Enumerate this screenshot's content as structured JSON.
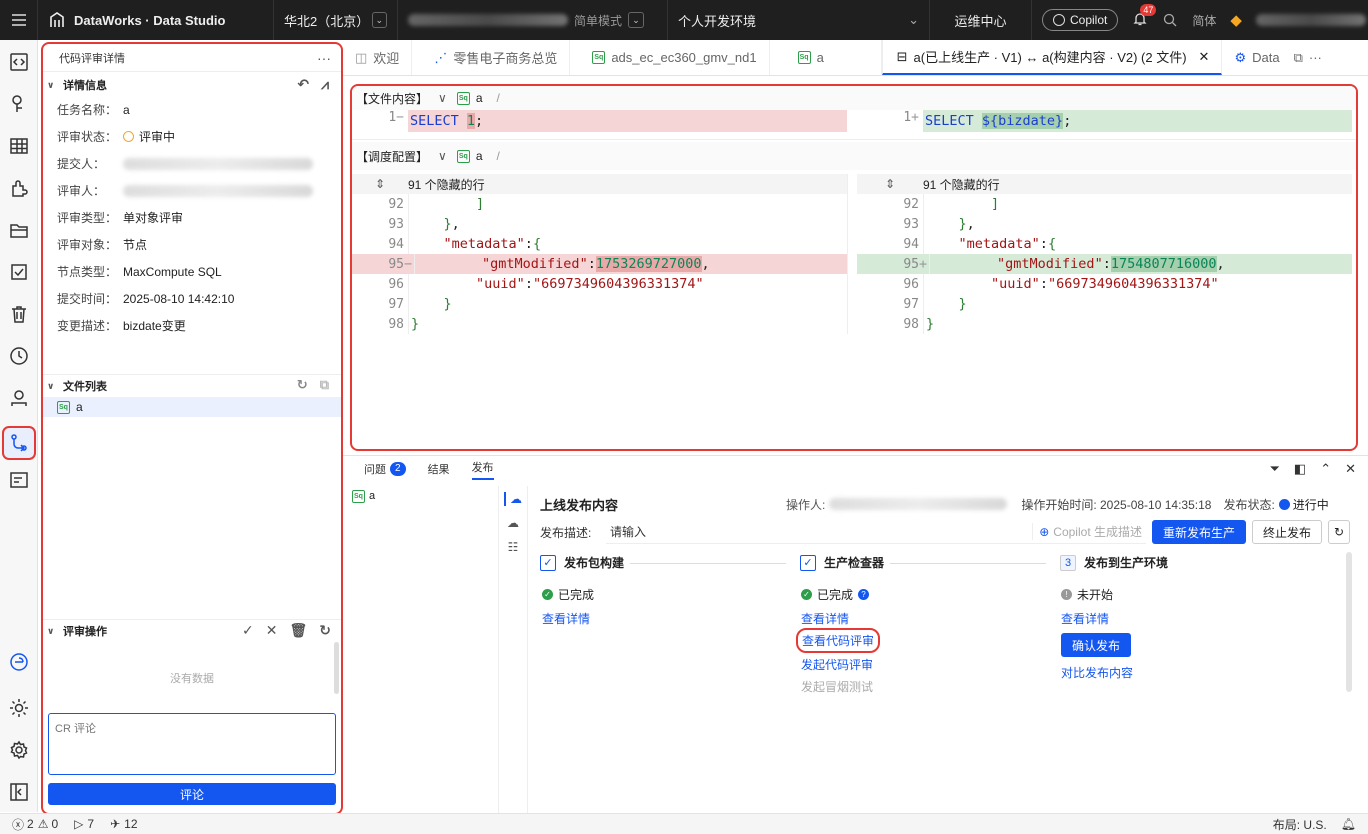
{
  "topbar": {
    "menu_icon": "menu-icon",
    "logo_text": "DataWorks · Data Studio",
    "region": "华北2（北京）",
    "mode": "简单模式",
    "environment": "个人开发环境",
    "ops_center": "运维中心",
    "copilot": "Copilot",
    "notifications": "47",
    "language": "简体"
  },
  "left_panel": {
    "title": "代码评审详情",
    "details_section": "详情信息",
    "fields": [
      {
        "key": "任务名称：",
        "value": "a"
      },
      {
        "key": "评审状态：",
        "value": "评审中"
      },
      {
        "key": "提交人：",
        "value": ""
      },
      {
        "key": "评审人：",
        "value": ""
      },
      {
        "key": "评审类型：",
        "value": "单对象评审"
      },
      {
        "key": "评审对象：",
        "value": "节点"
      },
      {
        "key": "节点类型：",
        "value": "MaxCompute SQL"
      },
      {
        "key": "提交时间：",
        "value": "2025-08-10 14:42:10"
      },
      {
        "key": "变更描述：",
        "value": "bizdate变更"
      }
    ],
    "file_list_section": "文件列表",
    "file_badge": "Sq",
    "file_name": "a",
    "review_section": "评审操作",
    "no_data": "没有数据",
    "comment_placeholder": "CR 评论",
    "comment_button": "评论"
  },
  "tabs": [
    {
      "label": "欢迎",
      "icon": "dataworks-icon"
    },
    {
      "label": "零售电子商务总览",
      "icon": "workflow-icon"
    },
    {
      "label": "ads_ec_ec360_gmv_nd1",
      "icon": "sql-icon"
    },
    {
      "label": "a",
      "icon": "sql-icon"
    },
    {
      "label": "a(已上线生产 · V1) ↔ a(构建内容 · V2) (2 文件)",
      "icon": "diff-icon"
    },
    {
      "label": "Data",
      "icon": "gear-icon"
    }
  ],
  "diff": {
    "section1": "【文件内容】",
    "section2": "【调度配置】",
    "file": "a",
    "slash": "/",
    "hidden_rows": "91 个隐藏的行",
    "file_left": {
      "ln": "1",
      "mark": "−",
      "before": "SELECT ",
      "hl": "1",
      "after": ";"
    },
    "file_right": {
      "ln": "1",
      "mark": "+",
      "before": "SELECT ",
      "hl": "${bizdate}",
      "after": ";"
    },
    "left": [
      {
        "ln": "92",
        "text": "        ]"
      },
      {
        "ln": "93",
        "text": "    },"
      },
      {
        "ln": "94",
        "text": "    \"metadata\":{"
      },
      {
        "ln": "95",
        "mark": "−",
        "text": "        \"gmtModified\":",
        "hl": "1753269727000",
        "tail": ","
      },
      {
        "ln": "96",
        "text": "        \"uuid\":\"6697349604396331374\""
      },
      {
        "ln": "97",
        "text": "    }"
      },
      {
        "ln": "98",
        "text": "}"
      }
    ],
    "right": [
      {
        "ln": "92",
        "text": "        ]"
      },
      {
        "ln": "93",
        "text": "    },"
      },
      {
        "ln": "94",
        "text": "    \"metadata\":{"
      },
      {
        "ln": "95",
        "mark": "+",
        "text": "        \"gmtModified\":",
        "hl": "1754807716000",
        "tail": ","
      },
      {
        "ln": "96",
        "text": "        \"uuid\":\"6697349604396331374\""
      },
      {
        "ln": "97",
        "text": "    }"
      },
      {
        "ln": "98",
        "text": "}"
      }
    ]
  },
  "bottom": {
    "tabs": {
      "issues": "问题",
      "issues_count": "2",
      "results": "结果",
      "publish": "发布"
    },
    "file_badge": "Sq",
    "file": "a",
    "title": "上线发布内容",
    "operator_label": "操作人:",
    "start_time": "操作开始时间: 2025-08-10 14:35:18",
    "status_label": "发布状态:",
    "status_value": "进行中",
    "desc_label": "发布描述:",
    "desc_placeholder": "请输入",
    "copilot_gen": "Copilot 生成描述",
    "republish": "重新发布生产",
    "stop": "终止发布",
    "steps": [
      {
        "title": "发布包构建",
        "status": "已完成"
      },
      {
        "title": "生产检查器",
        "status": "已完成"
      },
      {
        "num": "3",
        "title": "发布到生产环境",
        "status": "未开始"
      }
    ],
    "view_details": "查看详情",
    "view_code_review": "查看代码评审",
    "start_code_review": "发起代码评审",
    "start_smoke_test": "发起冒烟测试",
    "confirm_publish": "确认发布",
    "compare_publish": "对比发布内容"
  },
  "statusbar": {
    "errors": "2",
    "warnings": "0",
    "runs": "7",
    "sends": "12",
    "layout": "布局: U.S."
  }
}
